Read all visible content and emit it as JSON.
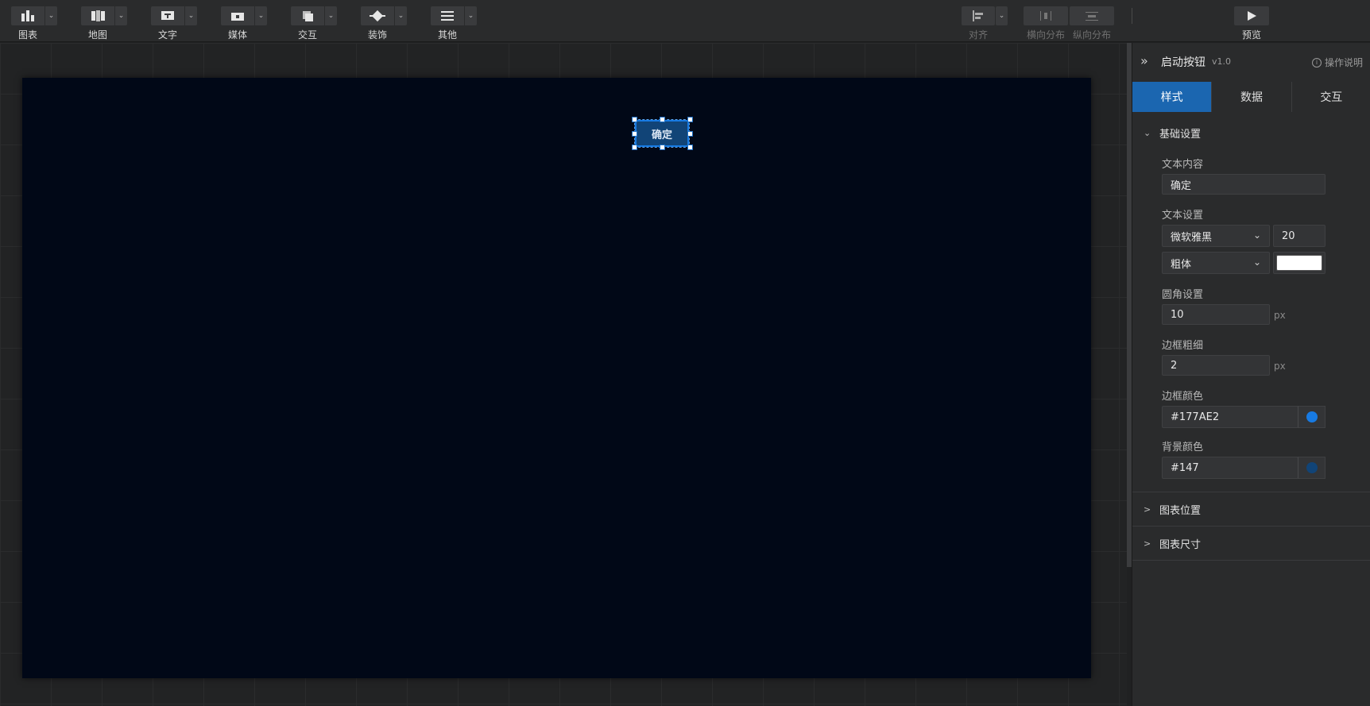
{
  "toolbar": {
    "tools": [
      {
        "label": "图表",
        "icon": "chart-icon"
      },
      {
        "label": "地图",
        "icon": "map-icon"
      },
      {
        "label": "文字",
        "icon": "text-icon"
      },
      {
        "label": "媒体",
        "icon": "media-icon"
      },
      {
        "label": "交互",
        "icon": "interaction-icon"
      },
      {
        "label": "装饰",
        "icon": "decoration-icon"
      },
      {
        "label": "其他",
        "icon": "other-icon"
      }
    ],
    "align_label": "对齐",
    "h_distribute_label": "横向分布",
    "v_distribute_label": "纵向分布",
    "preview_label": "预览"
  },
  "canvas": {
    "button_text": "确定",
    "stage_color": "#010817"
  },
  "panel": {
    "title": "启动按钮",
    "version": "v1.0",
    "help_text": "操作说明",
    "tabs": [
      {
        "label": "样式",
        "active": true
      },
      {
        "label": "数据",
        "active": false
      },
      {
        "label": "交互",
        "active": false
      }
    ],
    "basic": {
      "title": "基础设置",
      "text_content_label": "文本内容",
      "text_content_value": "确定",
      "text_settings_label": "文本设置",
      "font_family": "微软雅黑",
      "font_size": "20",
      "font_weight": "粗体",
      "font_color": "#ffffff",
      "radius_label": "圆角设置",
      "radius_value": "10",
      "radius_unit": "px",
      "border_width_label": "边框粗细",
      "border_width_value": "2",
      "border_width_unit": "px",
      "border_color_label": "边框颜色",
      "border_color_value": "#177AE2",
      "bg_color_label": "背景颜色",
      "bg_color_value": "#147"
    },
    "position_section": "图表位置",
    "size_section": "图表尺寸"
  }
}
